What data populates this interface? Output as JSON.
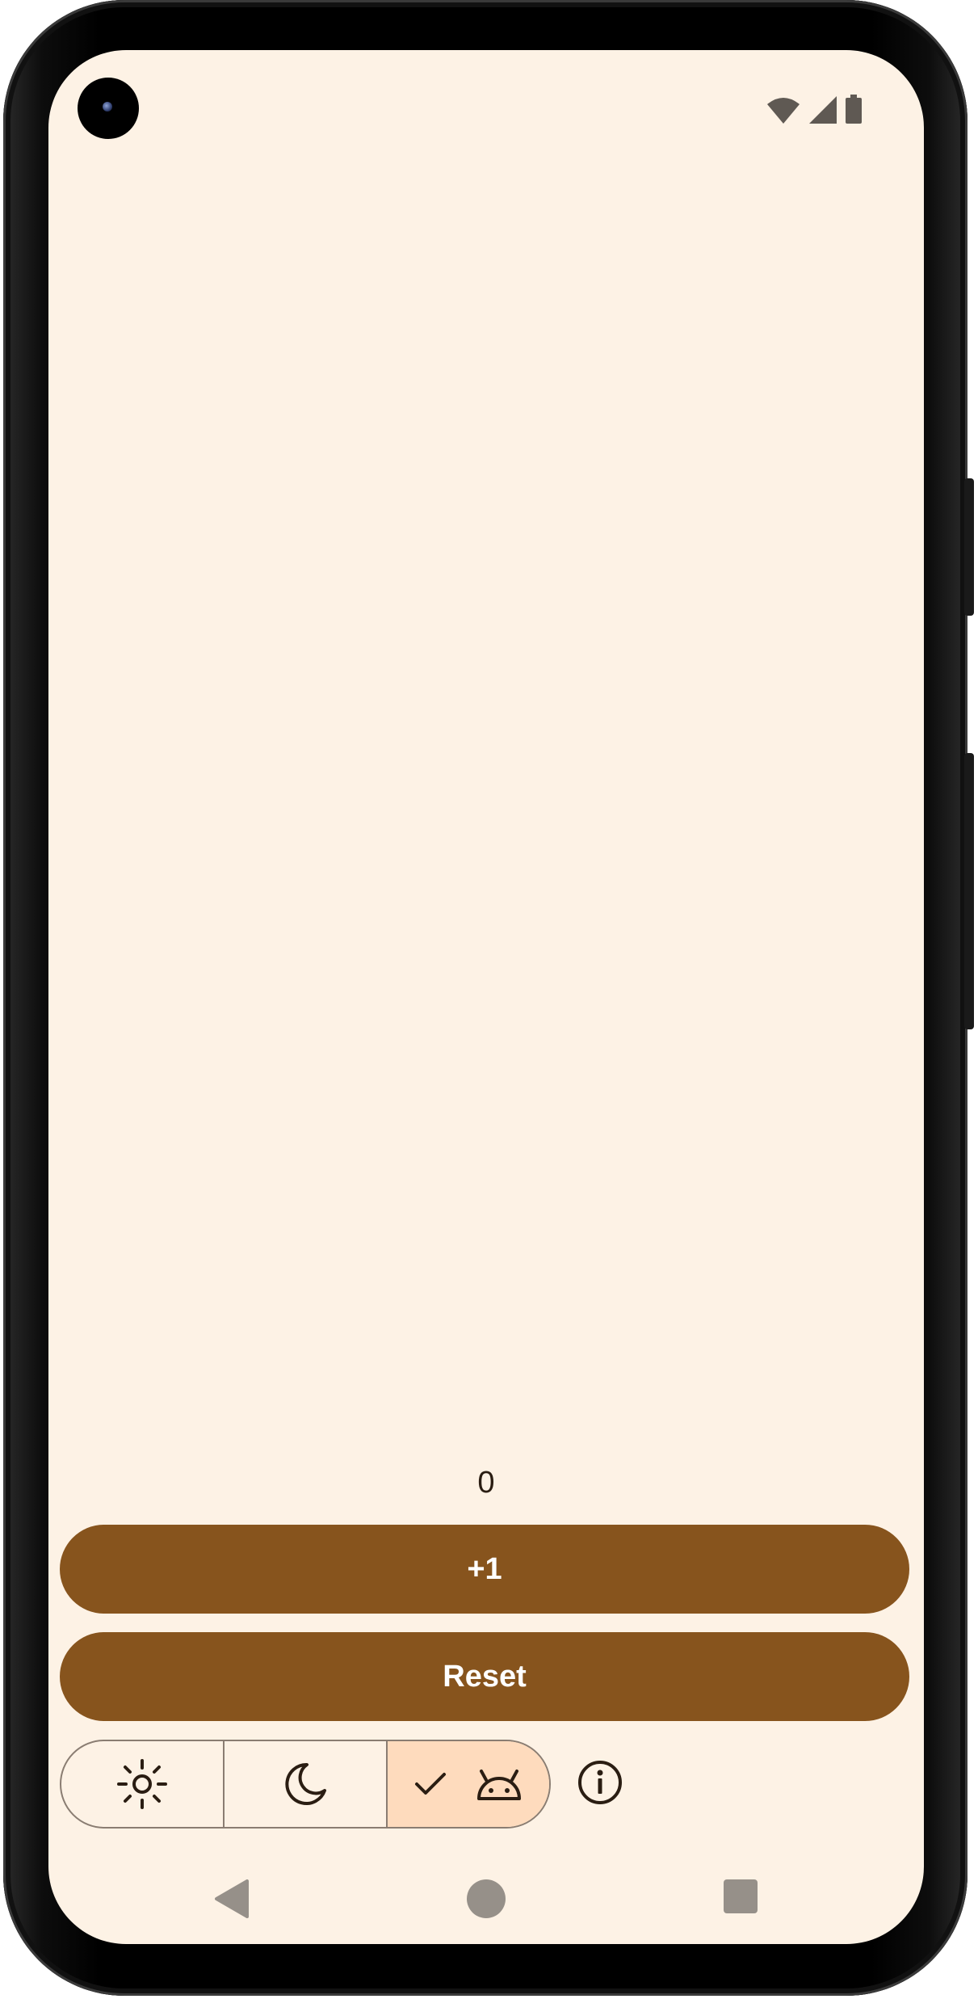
{
  "app": {
    "counter_value": "0",
    "increment_label": "+1",
    "reset_label": "Reset",
    "theme_options": [
      {
        "id": "light",
        "icon": "sun-icon",
        "selected": false
      },
      {
        "id": "dark",
        "icon": "moon-icon",
        "selected": false
      },
      {
        "id": "system",
        "icon": "android-icon",
        "selected": true
      }
    ],
    "info_icon": "info-icon"
  },
  "status_bar": {
    "icons": [
      "wifi-icon",
      "cellular-signal-icon",
      "battery-icon"
    ]
  },
  "navigation_bar": {
    "buttons": [
      "back-icon",
      "home-icon",
      "recents-icon"
    ]
  },
  "colors": {
    "background": "#fdf2e5",
    "primary_button": "#87541d",
    "selected_segment": "#fedbbd",
    "outline": "#8a7d72",
    "on_surface": "#2a1d12"
  }
}
